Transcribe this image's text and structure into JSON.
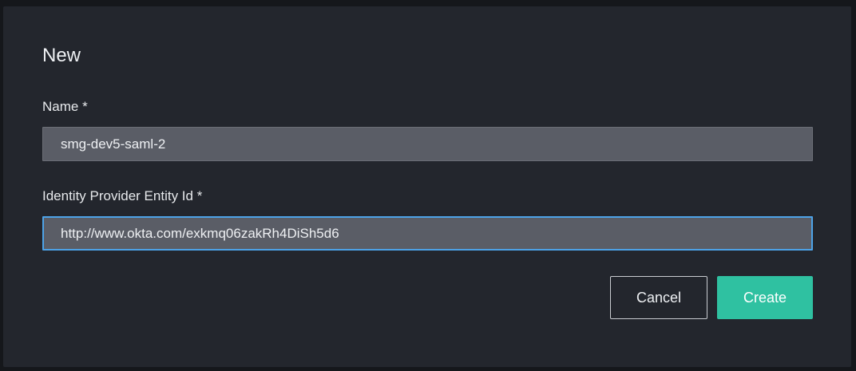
{
  "dialog": {
    "title": "New",
    "fields": {
      "name": {
        "label": "Name *",
        "value": "smg-dev5-saml-2"
      },
      "idp_entity_id": {
        "label": "Identity Provider Entity Id *",
        "value": "http://www.okta.com/exkmq06zakRh4DiSh5d6"
      }
    },
    "buttons": {
      "cancel_label": "Cancel",
      "create_label": "Create"
    }
  },
  "colors": {
    "background": "#15171b",
    "dialog": "#23262d",
    "input": "#5a5d66",
    "focus_border": "#4da3e8",
    "primary": "#2fc1a1"
  }
}
